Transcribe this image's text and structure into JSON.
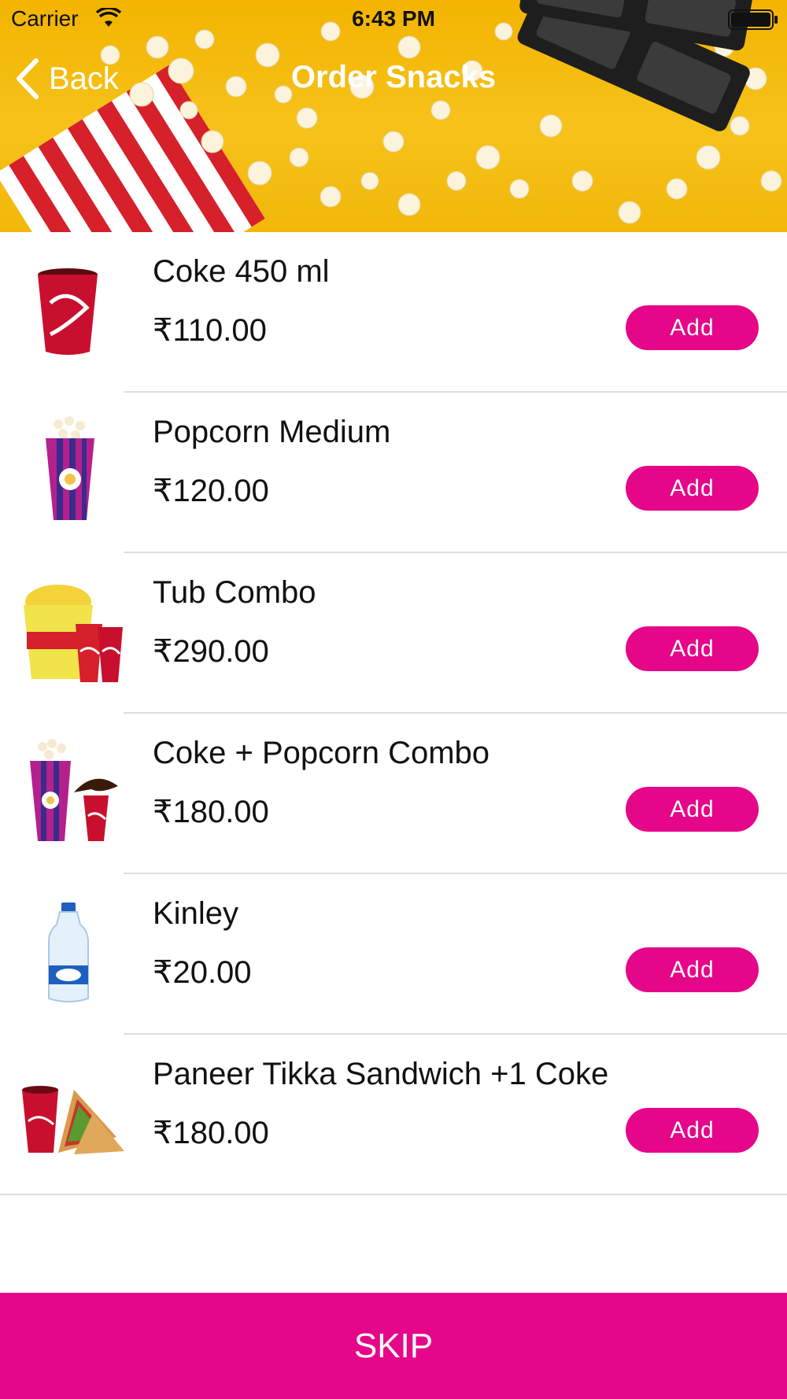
{
  "status_bar": {
    "carrier": "Carrier",
    "time": "6:43 PM"
  },
  "nav": {
    "back_label": "Back",
    "title": "Order Snacks"
  },
  "items": [
    {
      "name": "Coke 450 ml",
      "price": "₹110.00",
      "add_label": "Add",
      "icon": "coke-cup-icon"
    },
    {
      "name": "Popcorn Medium",
      "price": "₹120.00",
      "add_label": "Add",
      "icon": "popcorn-box-icon"
    },
    {
      "name": "Tub Combo",
      "price": "₹290.00",
      "add_label": "Add",
      "icon": "popcorn-tub-combo-icon"
    },
    {
      "name": "Coke + Popcorn Combo",
      "price": "₹180.00",
      "add_label": "Add",
      "icon": "coke-popcorn-combo-icon"
    },
    {
      "name": "Kinley",
      "price": "₹20.00",
      "add_label": "Add",
      "icon": "water-bottle-icon"
    },
    {
      "name": "Paneer Tikka Sandwich +1 Coke",
      "price": "₹180.00",
      "add_label": "Add",
      "icon": "sandwich-coke-icon"
    }
  ],
  "skip_label": "SKIP",
  "colors": {
    "accent": "#e6068a",
    "banner": "#f6c21a",
    "separator": "#dedede"
  }
}
